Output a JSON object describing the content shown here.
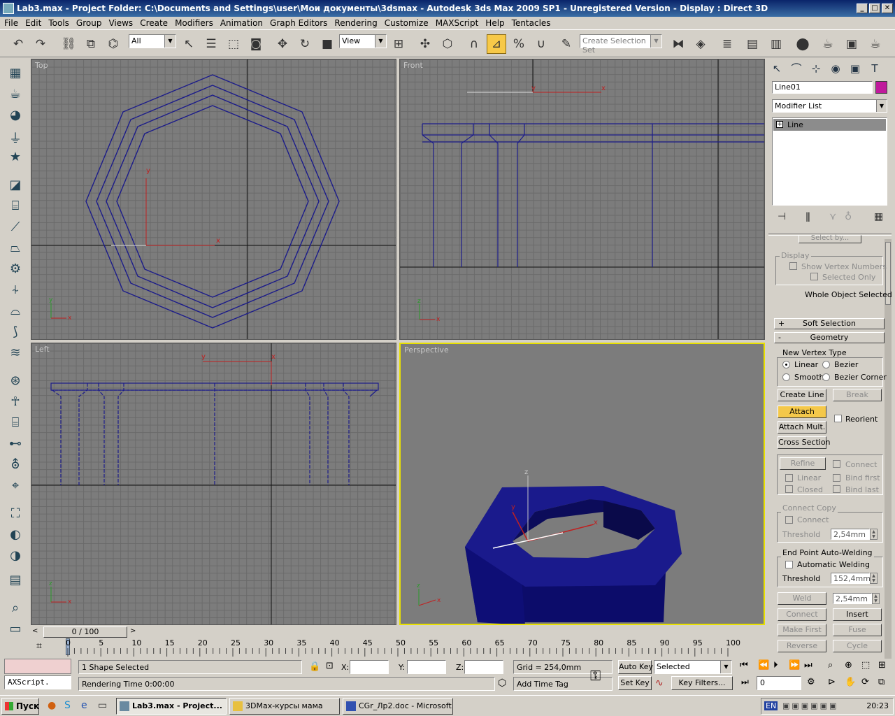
{
  "window": {
    "title": "Lab3.max     - Project Folder: C:\\Documents and Settings\\user\\Мои документы\\3dsmax     - Autodesk 3ds Max  2009 SP1   - Unregistered Version     - Display : Direct 3D",
    "minimize": "_",
    "maximize": "□",
    "close": "✕"
  },
  "menu": [
    "File",
    "Edit",
    "Tools",
    "Group",
    "Views",
    "Create",
    "Modifiers",
    "Animation",
    "Graph Editors",
    "Rendering",
    "Customize",
    "MAXScript",
    "Help",
    "Tentacles"
  ],
  "toolbar": {
    "filter_value": "All",
    "ref_coord_value": "View",
    "selection_set_placeholder": "Create Selection Set"
  },
  "viewports": {
    "top": "Top",
    "front": "Front",
    "left": "Left",
    "perspective": "Perspective"
  },
  "axes": {
    "x": "x",
    "y": "y",
    "z": "z"
  },
  "panel": {
    "object_name": "Line01",
    "object_color": "#c01a9c",
    "modifier_list": "Modifier List",
    "stack_item": "Line",
    "stack_expand": "+",
    "select_by": "Select by...",
    "display": {
      "label": "Display",
      "show_vertex_numbers": "Show Vertex Numbers",
      "selected_only": "Selected Only",
      "status": "Whole Object Selected"
    },
    "soft_selection": {
      "sign": "+",
      "label": "Soft Selection"
    },
    "geometry": {
      "sign": "-",
      "label": "Geometry",
      "new_vertex_type": "New Vertex Type",
      "linear": "Linear",
      "bezier": "Bezier",
      "smooth": "Smooth",
      "bezier_corner": "Bezier Corner",
      "create_line": "Create Line",
      "break": "Break",
      "attach": "Attach",
      "reorient": "Reorient",
      "attach_mult": "Attach Mult.",
      "cross_section": "Cross Section",
      "refine": "Refine",
      "connect": "Connect",
      "refine_linear": "Linear",
      "bind_first": "Bind first",
      "closed": "Closed",
      "bind_last": "Bind last",
      "connect_copy": "Connect Copy",
      "connect_copy_connect": "Connect",
      "threshold": "Threshold",
      "connect_threshold": "2,54mm",
      "end_point_welding": "End Point Auto-Welding",
      "automatic_welding": "Automatic Welding",
      "welding_threshold": "Threshold",
      "welding_threshold_value": "152,4mm",
      "weld": "Weld",
      "weld_value": "2,54mm",
      "connect_btn": "Connect",
      "insert": "Insert",
      "make_first": "Make First",
      "fuse": "Fuse",
      "reverse": "Reverse",
      "cycle": "Cycle"
    }
  },
  "timeslider": {
    "position": "0 / 100",
    "ticks": [
      "0",
      "5",
      "10",
      "15",
      "20",
      "25",
      "30",
      "35",
      "40",
      "45",
      "50",
      "55",
      "60",
      "65",
      "70",
      "75",
      "80",
      "85",
      "90",
      "95",
      "100"
    ]
  },
  "status": {
    "maxscript": "AXScript.",
    "selection": "1 Shape Selected",
    "rendering_time": "Rendering Time  0:00:00",
    "x_label": "X:",
    "y_label": "Y:",
    "z_label": "Z:",
    "grid": "Grid = 254,0mm",
    "add_time_tag": "Add Time Tag",
    "auto_key": "Auto Key",
    "set_key": "Set Key",
    "selected": "Selected",
    "key_filters": "Key Filters...",
    "frame": "0"
  },
  "taskbar": {
    "start": "Пуск",
    "tasks": [
      "Lab3.max     - Project...",
      "3DMax-курсы мама",
      "CGr_Лр2.doc - Microsoft..."
    ],
    "lang": "EN",
    "clock": "20:23"
  }
}
